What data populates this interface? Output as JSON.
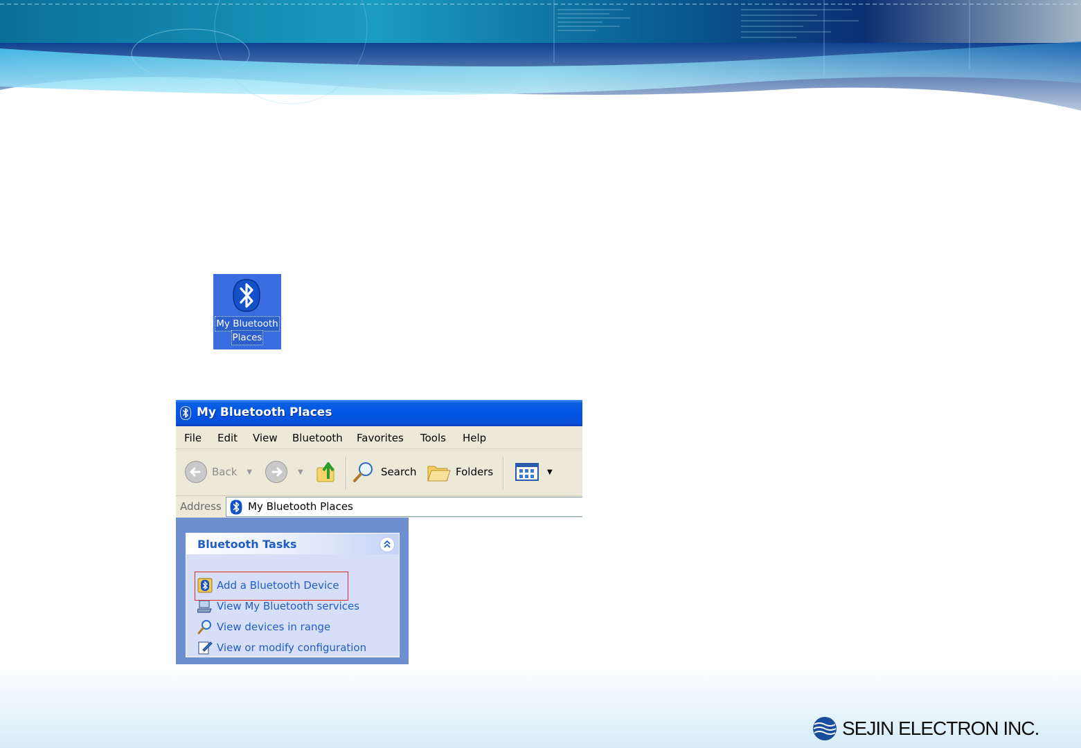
{
  "desktop_icon": {
    "label_line1": "My Bluetooth",
    "label_line2": "Places",
    "icon": "bluetooth-icon"
  },
  "window": {
    "title": "My Bluetooth Places",
    "title_icon": "bluetooth-icon",
    "menu": [
      "File",
      "Edit",
      "View",
      "Bluetooth",
      "Favorites",
      "Tools",
      "Help"
    ],
    "toolbar": {
      "back_label": "Back",
      "search_label": "Search",
      "folders_label": "Folders"
    },
    "address": {
      "label": "Address",
      "value": "My Bluetooth Places"
    },
    "task_pane": {
      "title": "Bluetooth Tasks",
      "tasks": [
        {
          "label": "Add a Bluetooth Device",
          "icon": "add-device-icon",
          "highlighted": true
        },
        {
          "label": "View My Bluetooth services",
          "icon": "computer-icon"
        },
        {
          "label": "View devices in range",
          "icon": "magnifier-icon"
        },
        {
          "label": "View or modify configuration",
          "icon": "config-icon"
        }
      ]
    }
  },
  "logo": {
    "text": "SEJIN ELECTRON INC."
  },
  "colors": {
    "xp_title_blue": "#0055e5",
    "task_link_blue": "#215dc6",
    "task_pane_bg": "#6d8fcf",
    "highlight_red": "#e0282e"
  }
}
